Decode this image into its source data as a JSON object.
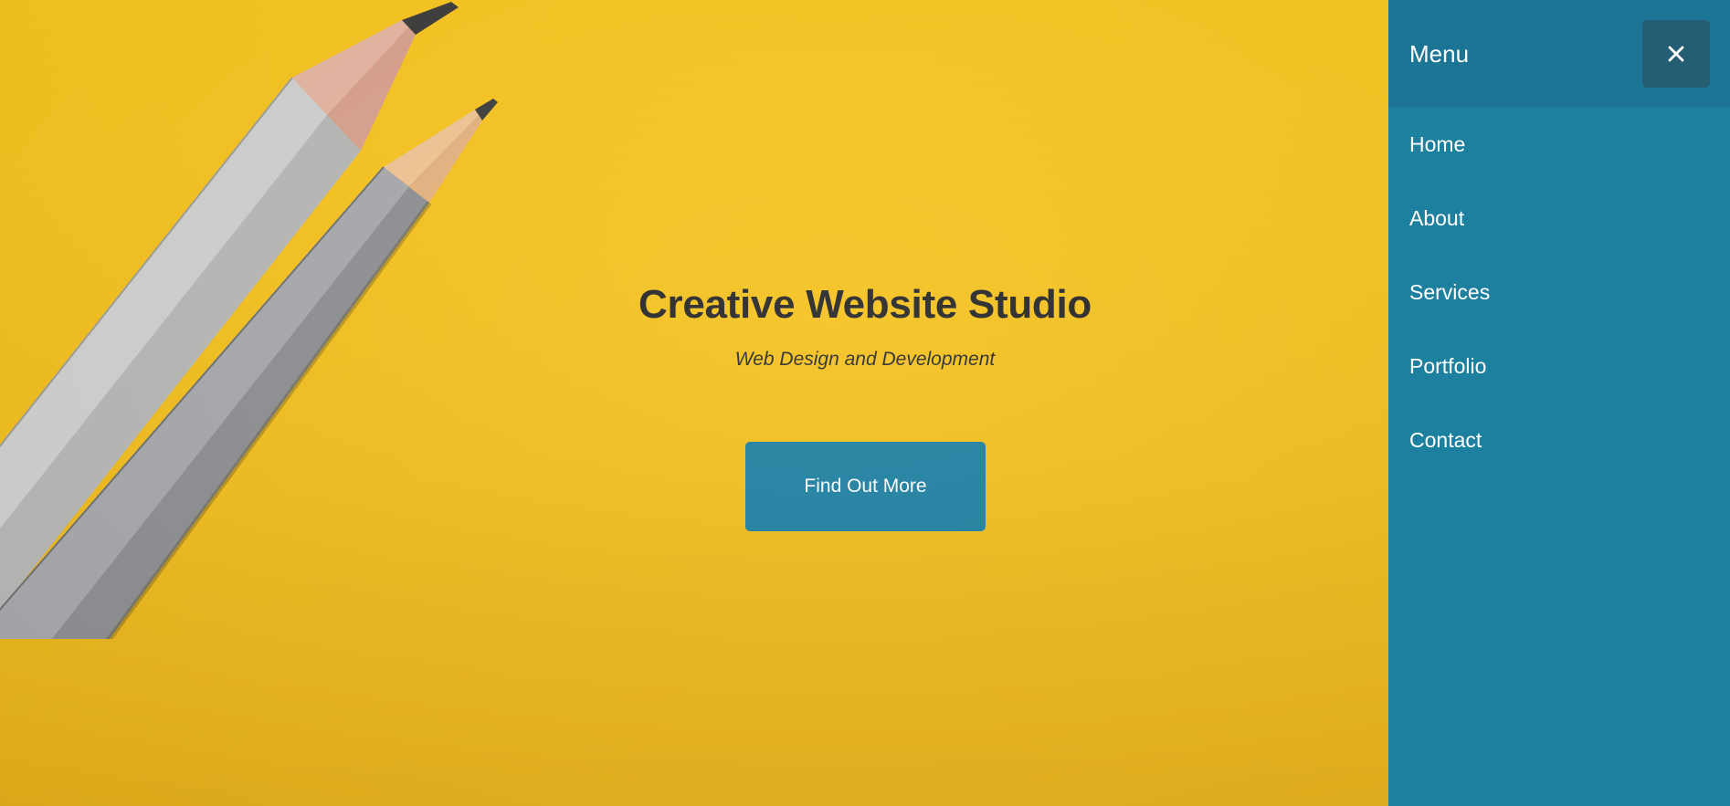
{
  "hero": {
    "title": "Creative Website Studio",
    "subtitle": "Web Design and Development",
    "cta_label": "Find Out More",
    "background_image": "pencils-on-yellow"
  },
  "sidebar": {
    "title": "Menu",
    "close_icon": "close-icon",
    "items": [
      {
        "label": "Home"
      },
      {
        "label": "About"
      },
      {
        "label": "Services"
      },
      {
        "label": "Portfolio"
      },
      {
        "label": "Contact"
      }
    ]
  },
  "colors": {
    "hero_background": "#f5c21d",
    "sidebar_background": "#1d809f",
    "sidebar_header": "#1c7594",
    "close_button": "#235e73",
    "cta_button": "#1e7fa0",
    "heading_text": "#262626"
  }
}
